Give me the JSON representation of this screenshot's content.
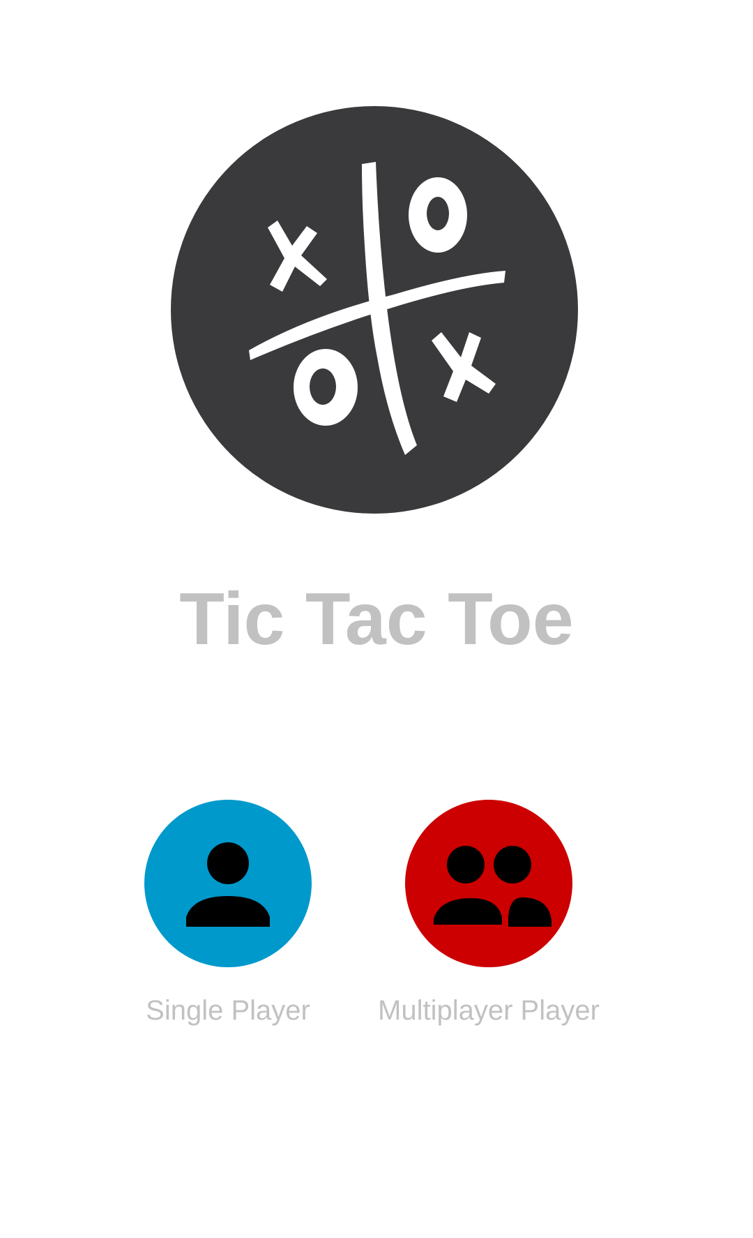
{
  "app": {
    "title": "Tic Tac Toe",
    "logo_icon": "tic-tac-toe-board-icon",
    "logo_color": "#3a3a3c",
    "title_color": "#c1c1c1"
  },
  "modes": [
    {
      "label": "Single Player",
      "icon": "person-icon",
      "color": "#0099cc"
    },
    {
      "label": "Multiplayer Player",
      "icon": "people-icon",
      "color": "#cc0000"
    }
  ],
  "label_color": "#c1c1c1"
}
